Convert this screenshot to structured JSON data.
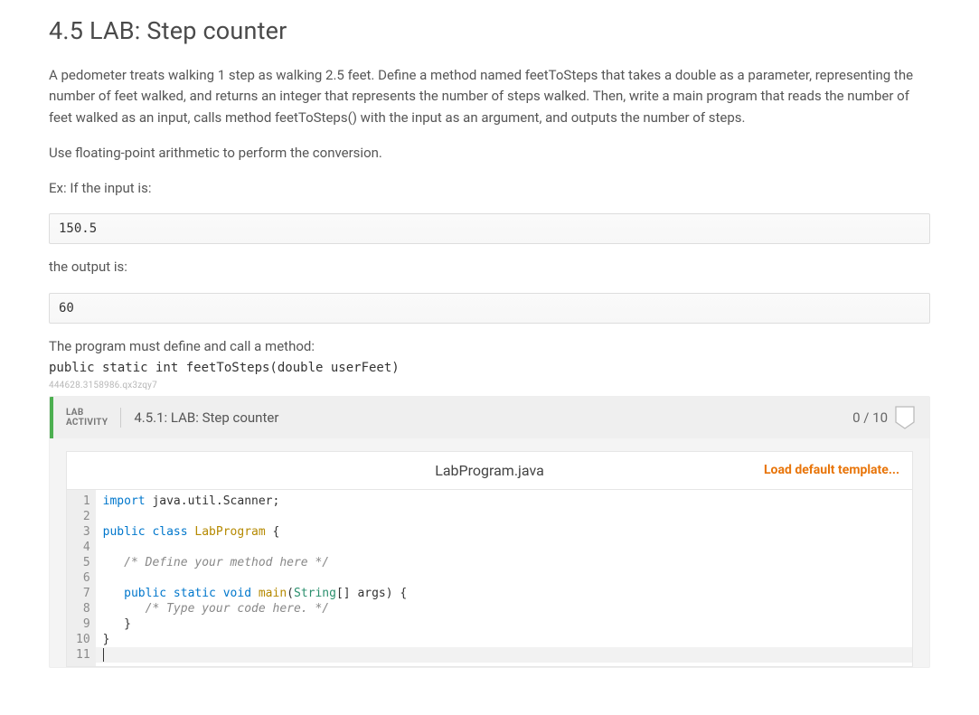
{
  "title": "4.5 LAB: Step counter",
  "para1": "A pedometer treats walking 1 step as walking 2.5 feet. Define a method named feetToSteps that takes a double as a parameter, representing the number of feet walked, and returns an integer that represents the number of steps walked. Then, write a main program that reads the number of feet walked as an input, calls method feetToSteps() with the input as an argument, and outputs the number of steps.",
  "para2": "Use floating-point arithmetic to perform the conversion.",
  "ex_label": "Ex: If the input is:",
  "input_sample": "150.5",
  "output_label": "the output is:",
  "output_sample": "60",
  "define_call": "The program must define and call a method:",
  "method_sig": "public static int feetToSteps(double userFeet)",
  "tiny_id": "444628.3158986.qx3zqy7",
  "activity": {
    "label_line1": "LAB",
    "label_line2": "ACTIVITY",
    "title": "4.5.1: LAB: Step counter",
    "score": "0 / 10"
  },
  "file": {
    "name": "LabProgram.java",
    "load_template": "Load default template..."
  },
  "code": {
    "line_count": 11,
    "lines": [
      {
        "n": 1,
        "tokens": [
          {
            "t": "import ",
            "c": "tok-kw"
          },
          {
            "t": "java.util.Scanner;",
            "c": ""
          }
        ]
      },
      {
        "n": 2,
        "tokens": []
      },
      {
        "n": 3,
        "tokens": [
          {
            "t": "public class ",
            "c": "tok-kw"
          },
          {
            "t": "LabProgram",
            "c": "tok-cls"
          },
          {
            "t": " {",
            "c": ""
          }
        ]
      },
      {
        "n": 4,
        "tokens": []
      },
      {
        "n": 5,
        "tokens": [
          {
            "t": "   /* Define your method here */",
            "c": "tok-cmt"
          }
        ]
      },
      {
        "n": 6,
        "tokens": []
      },
      {
        "n": 7,
        "tokens": [
          {
            "t": "   ",
            "c": ""
          },
          {
            "t": "public static ",
            "c": "tok-kw"
          },
          {
            "t": "void ",
            "c": "tok-kw"
          },
          {
            "t": "main",
            "c": "tok-cls"
          },
          {
            "t": "(",
            "c": ""
          },
          {
            "t": "String",
            "c": "tok-type"
          },
          {
            "t": "[] args) {",
            "c": ""
          }
        ]
      },
      {
        "n": 8,
        "tokens": [
          {
            "t": "      /* Type your code here. */",
            "c": "tok-cmt"
          }
        ]
      },
      {
        "n": 9,
        "tokens": [
          {
            "t": "   }",
            "c": ""
          }
        ]
      },
      {
        "n": 10,
        "tokens": [
          {
            "t": "}",
            "c": ""
          }
        ]
      },
      {
        "n": 11,
        "tokens": []
      }
    ]
  }
}
